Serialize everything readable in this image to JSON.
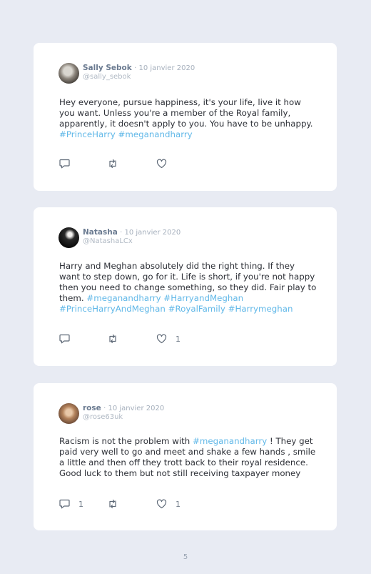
{
  "tweets": [
    {
      "name": "Sally Sebok",
      "date": "· 10 janvier 2020",
      "handle": "@sally_sebok",
      "text_before": "Hey everyone, pursue happiness, it's your life, live it how you want. Unless you're a member of the Royal family, apparently, it doesn't apply to you. You have to be unhappy. ",
      "hashtags": "#PrinceHarry #meganandharry",
      "text_after": "",
      "likes": "",
      "replies": ""
    },
    {
      "name": "Natasha",
      "date": "· 10 janvier 2020",
      "handle": "@NatashaLCx",
      "text_before": "Harry and Meghan absolutely did the right thing. If they want to step down, go for it. Life is short, if you're not happy then you need to change something, so they did. Fair play to them. ",
      "hashtags": "#meganandharry #HarryandMeghan #PrinceHarryAndMeghan #RoyalFamily #Harrymeghan",
      "text_after": "",
      "likes": "1",
      "replies": ""
    },
    {
      "name": "rose",
      "date": "· 10 janvier 2020",
      "handle": "@rose63uk",
      "text_before": "Racism is not the problem with ",
      "hashtags": "#meganandharry",
      "text_after": " ! They get paid very well to go and meet and shake a few hands , smile a little and then off they trott back to their royal residence. Good luck to them but not still receiving taxpayer money",
      "likes": "1",
      "replies": "1"
    }
  ],
  "icons": {
    "reply": "reply-icon",
    "retweet": "retweet-icon",
    "like": "heart-icon"
  },
  "colors": {
    "hashtag": "#61b8e8",
    "background": "#e8ebf3"
  },
  "page_number": "5"
}
